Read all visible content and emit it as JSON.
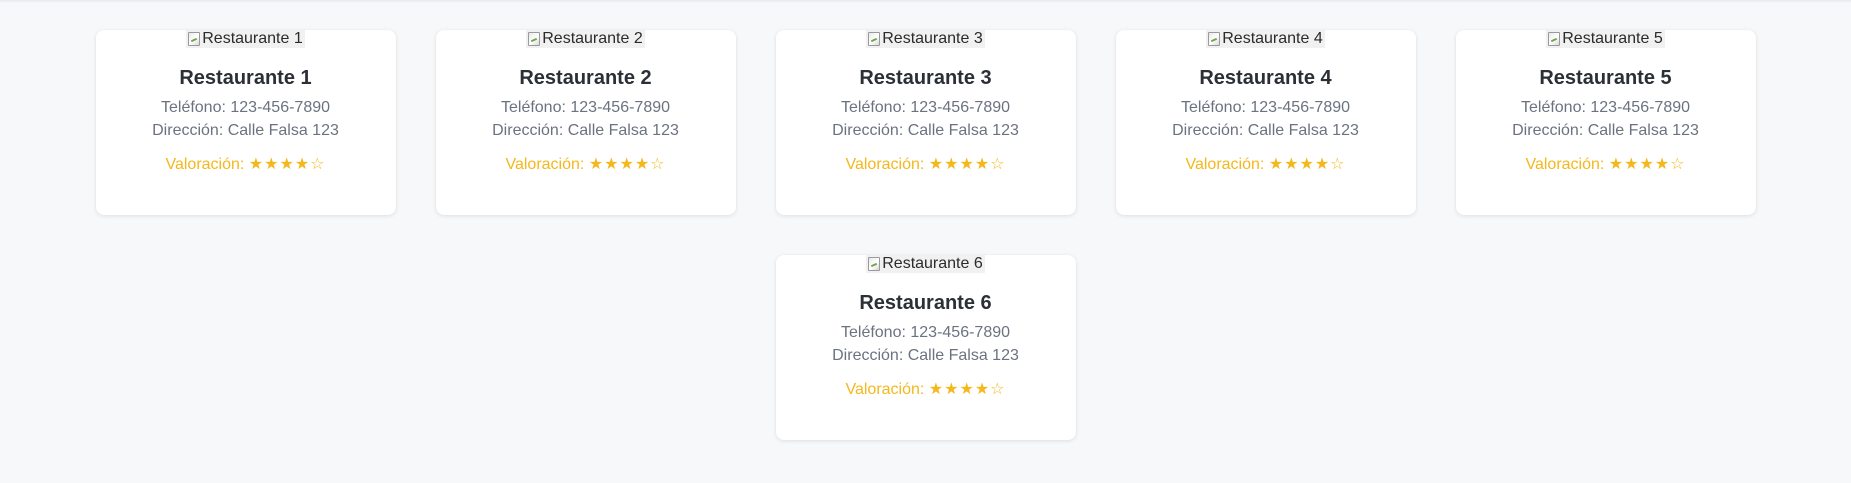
{
  "restaurants": [
    {
      "img_alt": "Restaurante 1",
      "name": "Restaurante 1",
      "phone": "Teléfono: 123-456-7890",
      "address": "Dirección: Calle Falsa 123",
      "rating_label": "Valoración:",
      "stars": "★★★★☆",
      "rating_value": 4,
      "rating_max": 5
    },
    {
      "img_alt": "Restaurante 2",
      "name": "Restaurante 2",
      "phone": "Teléfono: 123-456-7890",
      "address": "Dirección: Calle Falsa 123",
      "rating_label": "Valoración:",
      "stars": "★★★★☆",
      "rating_value": 4,
      "rating_max": 5
    },
    {
      "img_alt": "Restaurante 3",
      "name": "Restaurante 3",
      "phone": "Teléfono: 123-456-7890",
      "address": "Dirección: Calle Falsa 123",
      "rating_label": "Valoración:",
      "stars": "★★★★☆",
      "rating_value": 4,
      "rating_max": 5
    },
    {
      "img_alt": "Restaurante 4",
      "name": "Restaurante 4",
      "phone": "Teléfono: 123-456-7890",
      "address": "Dirección: Calle Falsa 123",
      "rating_label": "Valoración:",
      "stars": "★★★★☆",
      "rating_value": 4,
      "rating_max": 5
    },
    {
      "img_alt": "Restaurante 5",
      "name": "Restaurante 5",
      "phone": "Teléfono: 123-456-7890",
      "address": "Dirección: Calle Falsa 123",
      "rating_label": "Valoración:",
      "stars": "★★★★☆",
      "rating_value": 4,
      "rating_max": 5
    },
    {
      "img_alt": "Restaurante 6",
      "name": "Restaurante 6",
      "phone": "Teléfono: 123-456-7890",
      "address": "Dirección: Calle Falsa 123",
      "rating_label": "Valoración:",
      "stars": "★★★★☆",
      "rating_value": 4,
      "rating_max": 5
    }
  ],
  "colors": {
    "background": "#f7f8fa",
    "card": "#ffffff",
    "title": "#2b2f36",
    "muted_text": "#6b7280",
    "rating": "#f5b81c"
  },
  "icons": {
    "image_placeholder": "broken-image-icon"
  }
}
